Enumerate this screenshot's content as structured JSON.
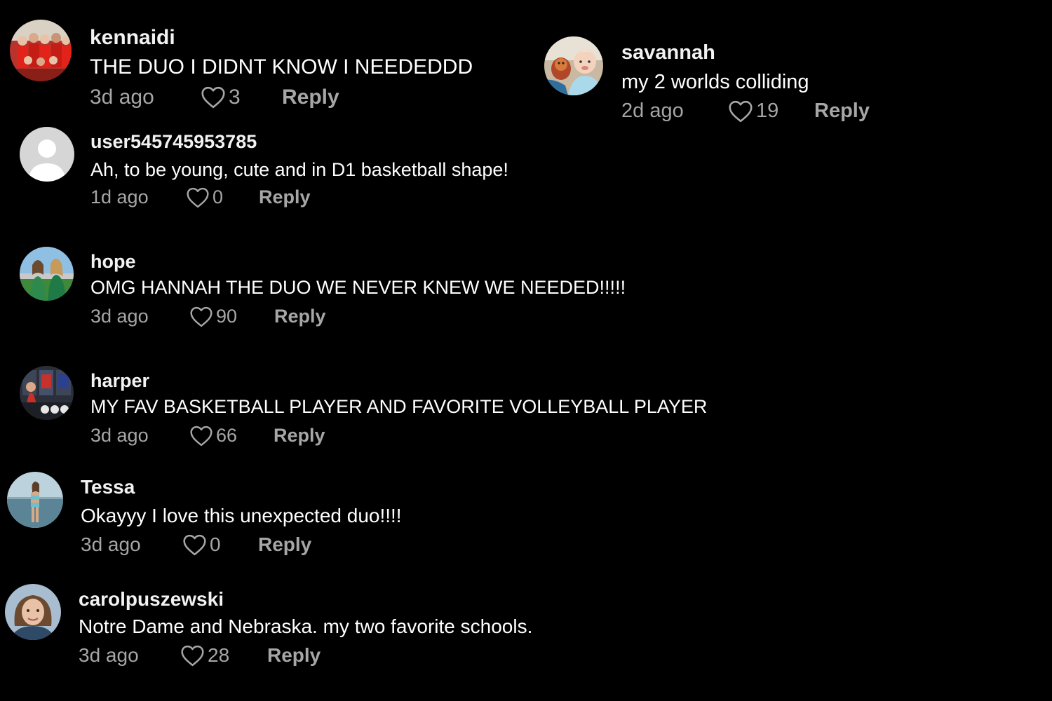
{
  "comments": [
    {
      "username": "kennaidi",
      "text": "THE DUO I DIDNT KNOW I NEEDEDDD",
      "time": "3d ago",
      "likes": "3",
      "reply_label": "Reply",
      "avatar_icon": "team-photo-avatar"
    },
    {
      "username": "savannah",
      "text": "my 2 worlds colliding",
      "time": "2d ago",
      "likes": "19",
      "reply_label": "Reply",
      "avatar_icon": "baby-photo-avatar"
    },
    {
      "username": "user545745953785",
      "text": "Ah, to be young, cute and in D1 basketball shape!",
      "time": "1d ago",
      "likes": "0",
      "reply_label": "Reply",
      "avatar_icon": "default-user-avatar"
    },
    {
      "username": "hope",
      "text": "OMG HANNAH THE DUO WE NEVER KNEW WE NEEDED!!!!!",
      "time": "3d ago",
      "likes": "90",
      "reply_label": "Reply",
      "avatar_icon": "friends-photo-avatar"
    },
    {
      "username": "harper",
      "text": "MY FAV BASKETBALL PLAYER AND FAVORITE VOLLEYBALL PLAYER",
      "time": "3d ago",
      "likes": "66",
      "reply_label": "Reply",
      "avatar_icon": "locker-room-photo-avatar"
    },
    {
      "username": "Tessa",
      "text": "Okayyy I love this unexpected duo!!!!",
      "time": "3d ago",
      "likes": "0",
      "reply_label": "Reply",
      "avatar_icon": "beach-photo-avatar"
    },
    {
      "username": "carolpuszewski",
      "text": "Notre Dame and Nebraska. my two favorite schools.",
      "time": "3d ago",
      "likes": "28",
      "reply_label": "Reply",
      "avatar_icon": "portrait-photo-avatar"
    }
  ],
  "colors": {
    "background": "#000000",
    "username": "#f2f2f2",
    "text": "#ffffff",
    "meta": "#a6a6a6"
  },
  "icons": {
    "like": "heart-outline-icon"
  }
}
